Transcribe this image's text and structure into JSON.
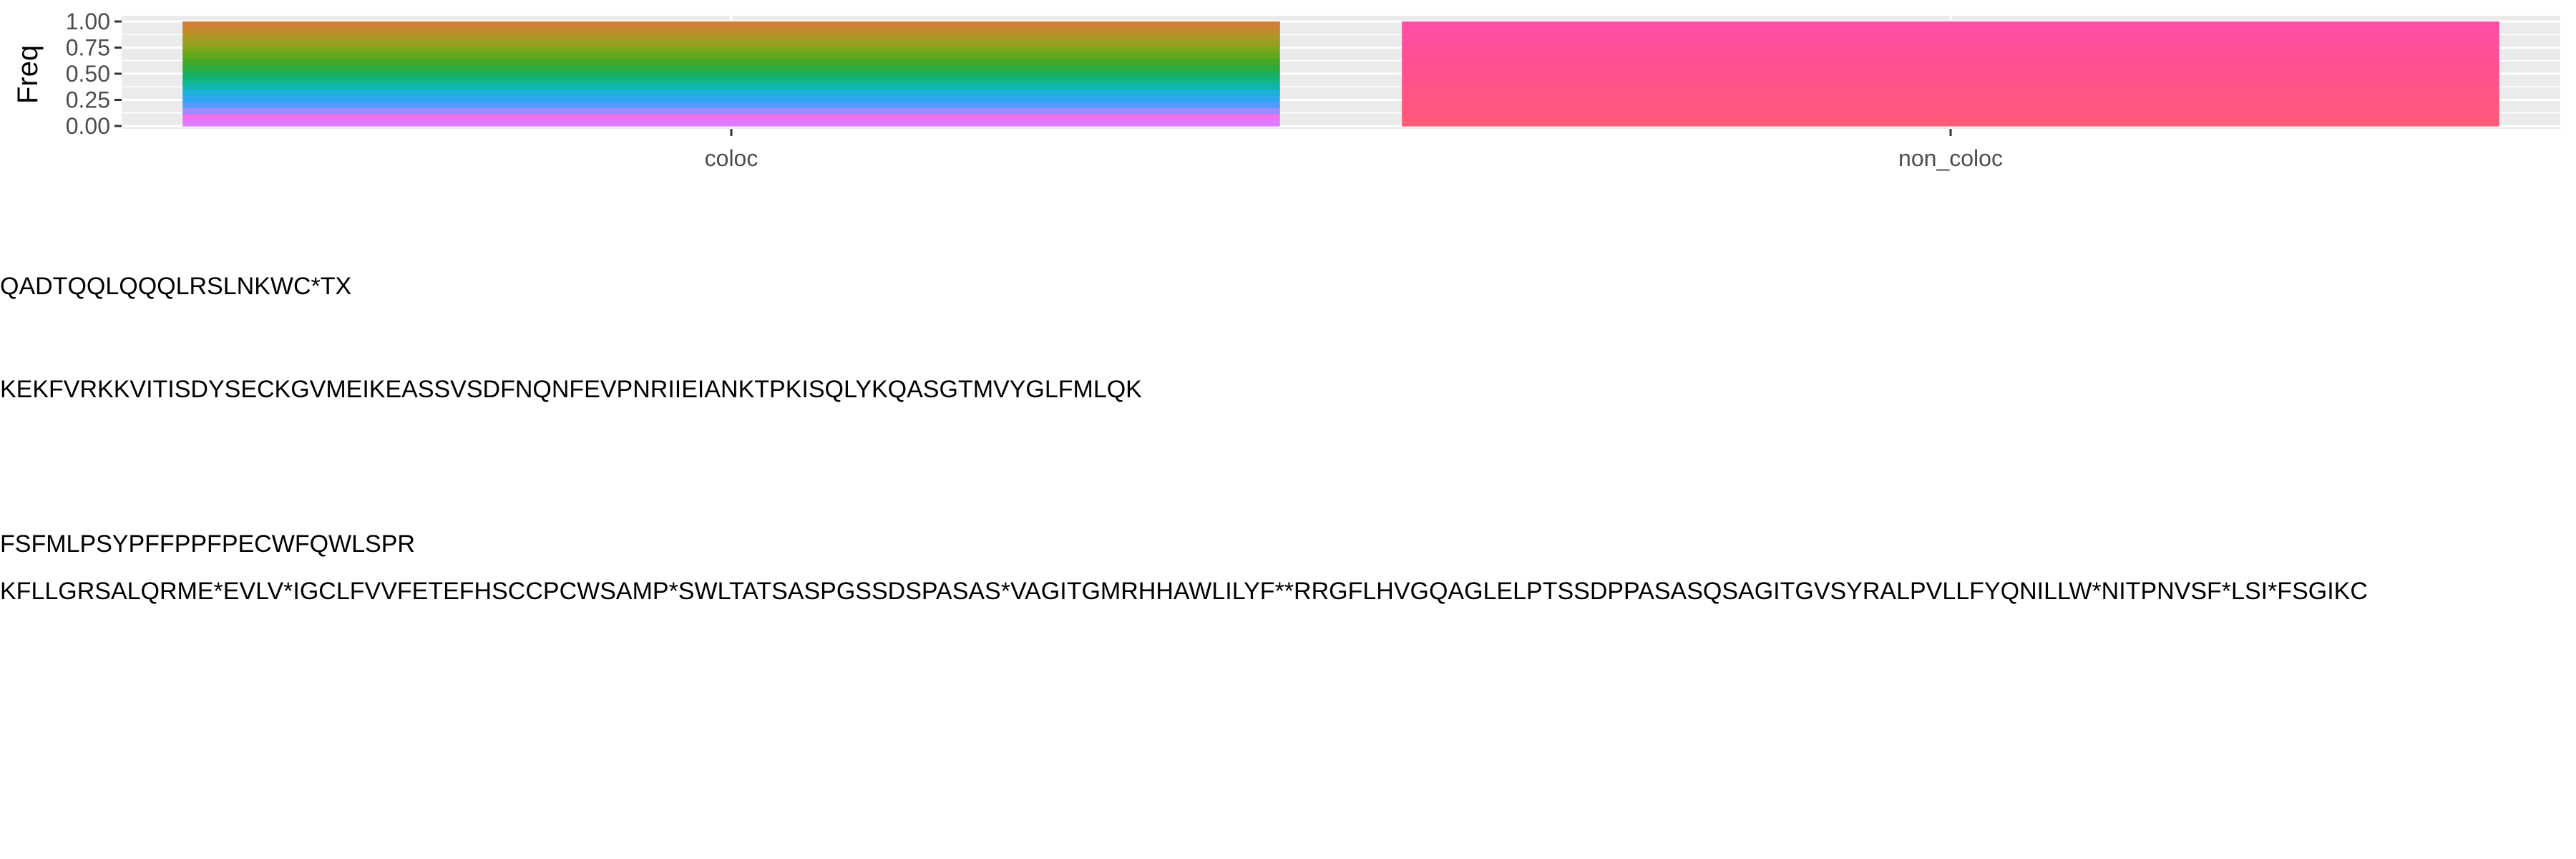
{
  "chart_data": {
    "type": "bar",
    "stacked": true,
    "ylabel": "Freq",
    "xlabel": "",
    "ylim": [
      0,
      1
    ],
    "yticks": [
      "0.00",
      "0.25",
      "0.50",
      "0.75",
      "1.00"
    ],
    "categories": [
      "coloc",
      "non_coloc"
    ],
    "grid": true,
    "legend": "none",
    "stack_colors": {
      "coloc": [
        "#e07bff",
        "#f070f0",
        "#9a8cff",
        "#4f9eff",
        "#2fa6f0",
        "#1cb0d8",
        "#10b6ae",
        "#10b584",
        "#18b060",
        "#2dab3c",
        "#44a828",
        "#5ea81c",
        "#7ca51e",
        "#989e22",
        "#ad9726",
        "#c08a2a",
        "#d07f34"
      ],
      "non_coloc": [
        "#ff5a78",
        "#ff577d",
        "#ff5582",
        "#ff5487",
        "#ff528c",
        "#ff5191",
        "#ff5096",
        "#ff4f9b",
        "#ff4fa0",
        "#ff4fa5"
      ]
    }
  },
  "sequences": {
    "line1": "QADTQQLQQQLRSLNKWC*TX",
    "line2": "KEKFVRKKVITISDYSECKGVMEIKEASSVSDFNQNFEVPNRIIEIANKTPKISQLYKQASGTMVYGLFMLQK",
    "line3": "FSFMLPSYPFFPPFPECWFQWLSPR",
    "line4": "KFLLGRSALQRME*EVLV*IGCLFVVFETEFHSCCPCWSAMP*SWLTATSASPGSSDSPASAS*VAGITGMRHHAWLILYF**RRGFLHVGQAGLELPTSSDPPASASQSAGITGVSYRALPVLLFYQNILLW*NITPNVSF*LSI*FSGIKC"
  }
}
